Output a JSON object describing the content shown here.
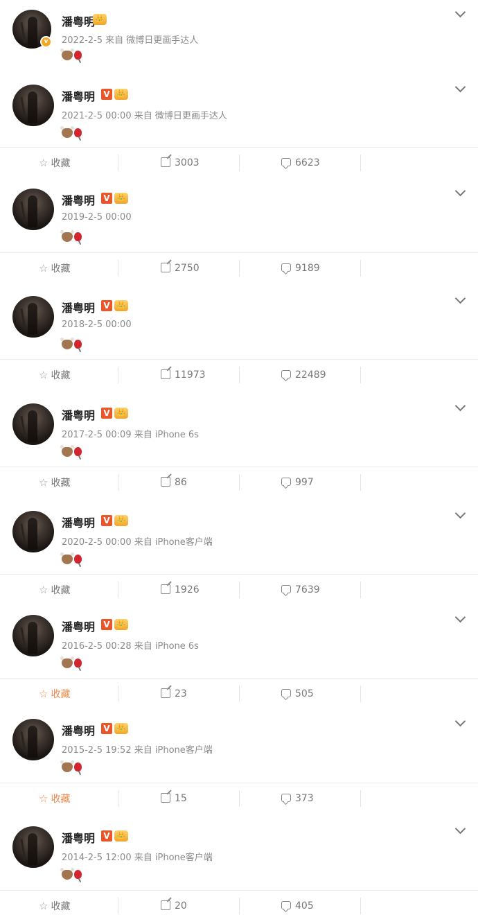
{
  "user_name": "潘粤明",
  "actions_label": "收藏",
  "posts": [
    {
      "date": "2022-2-5",
      "source": "来自 微博日更画手达人",
      "reposts": "",
      "comments": "",
      "fav_active": false
    },
    {
      "date": "2021-2-5 00:00",
      "source": "来自 微博日更画手达人",
      "reposts": "3003",
      "comments": "6623",
      "fav_active": false
    },
    {
      "date": "2019-2-5 00:00",
      "source": "",
      "reposts": "2750",
      "comments": "9189",
      "fav_active": false
    },
    {
      "date": "2018-2-5 00:00",
      "source": "",
      "reposts": "11973",
      "comments": "22489",
      "fav_active": false
    },
    {
      "date": "2017-2-5 00:09",
      "source": "来自 iPhone 6s",
      "reposts": "86",
      "comments": "997",
      "fav_active": false
    },
    {
      "date": "2020-2-5 00:00",
      "source": "来自 iPhone客户端",
      "reposts": "1926",
      "comments": "7639",
      "fav_active": false
    },
    {
      "date": "2016-2-5 00:28",
      "source": "来自 iPhone 6s",
      "reposts": "23",
      "comments": "505",
      "fav_active": true
    },
    {
      "date": "2015-2-5 19:52",
      "source": "来自 iPhone客户端",
      "reposts": "15",
      "comments": "373",
      "fav_active": true
    },
    {
      "date": "2014-2-5 12:00",
      "source": "来自 iPhone客户端",
      "reposts": "20",
      "comments": "405",
      "fav_active": false
    }
  ],
  "icons": {
    "avatar_badge": "v",
    "verified": "V",
    "crown": "👑"
  },
  "colors": {
    "accent": "#f08a4b",
    "verified": "#e8562a",
    "muted": "#8a8a8a"
  }
}
